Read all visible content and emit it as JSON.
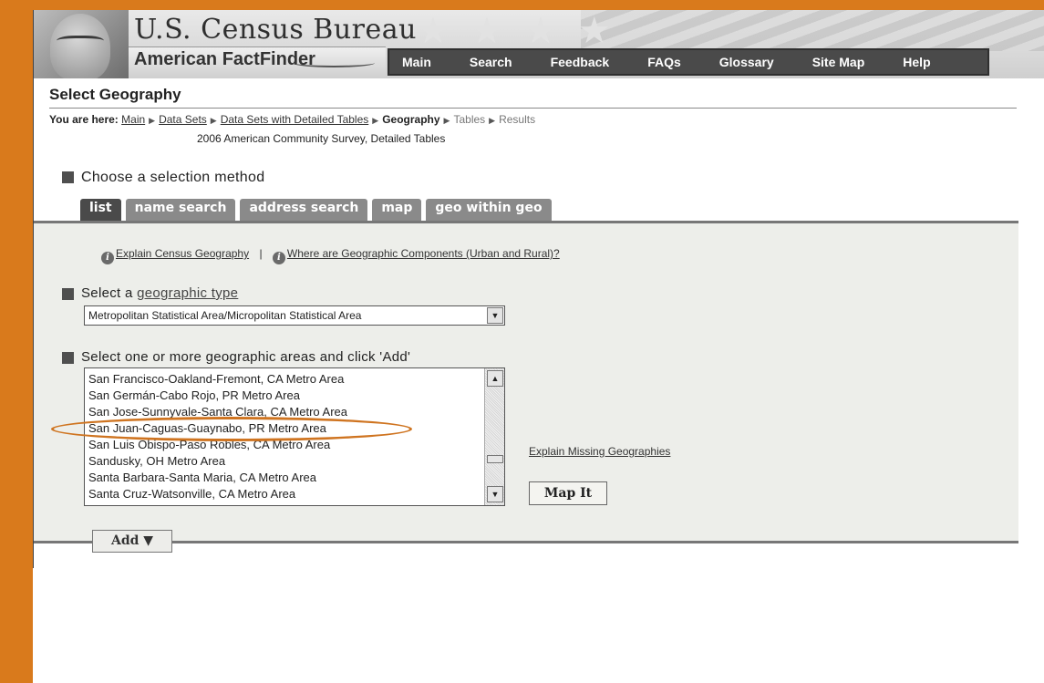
{
  "header": {
    "bureau_title": "U.S. Census Bureau",
    "app_name": "American FactFinder",
    "nav": [
      "Main",
      "Search",
      "Feedback",
      "FAQs",
      "Glossary",
      "Site Map",
      "Help"
    ]
  },
  "page": {
    "title": "Select Geography",
    "breadcrumb_label": "You are here:",
    "breadcrumbs": [
      {
        "text": "Main",
        "link": true
      },
      {
        "text": "Data Sets",
        "link": true
      },
      {
        "text": "Data Sets with Detailed Tables",
        "link": true
      },
      {
        "text": "Geography",
        "current": true
      },
      {
        "text": "Tables",
        "future": true
      },
      {
        "text": "Results",
        "future": true
      }
    ],
    "subtitle": "2006 American Community Survey, Detailed Tables"
  },
  "selection": {
    "label": "Choose a selection method",
    "tabs": [
      "list",
      "name search",
      "address search",
      "map",
      "geo within geo"
    ],
    "active_tab": "list"
  },
  "panel": {
    "explain_link": "Explain Census Geography",
    "separator": "|",
    "components_link": "Where are Geographic Components (Urban and Rural)?",
    "geo_type_prefix": "Select a ",
    "geo_type_link": "geographic type",
    "geo_type_value": "Metropolitan Statistical Area/Micropolitan Statistical Area",
    "areas_label": "Select one or more geographic areas and click 'Add'",
    "areas": [
      "San Francisco-Oakland-Fremont, CA Metro Area",
      "San Germán-Cabo Rojo, PR Metro Area",
      "San Jose-Sunnyvale-Santa Clara, CA Metro Area",
      "San Juan-Caguas-Guaynabo, PR Metro Area",
      "San Luis Obispo-Paso Robles, CA Metro Area",
      "Sandusky, OH Metro Area",
      "Santa Barbara-Santa Maria, CA Metro Area",
      "Santa Cruz-Watsonville, CA Metro Area"
    ],
    "highlighted_area": "San Juan-Caguas-Guaynabo, PR Metro Area",
    "missing_link": "Explain Missing Geographies",
    "map_it": "Map It",
    "add_button": "Add ▼"
  },
  "colors": {
    "frame": "#d97a1c",
    "highlight": "#cf7420",
    "nav_bg": "#4a4a4a"
  }
}
